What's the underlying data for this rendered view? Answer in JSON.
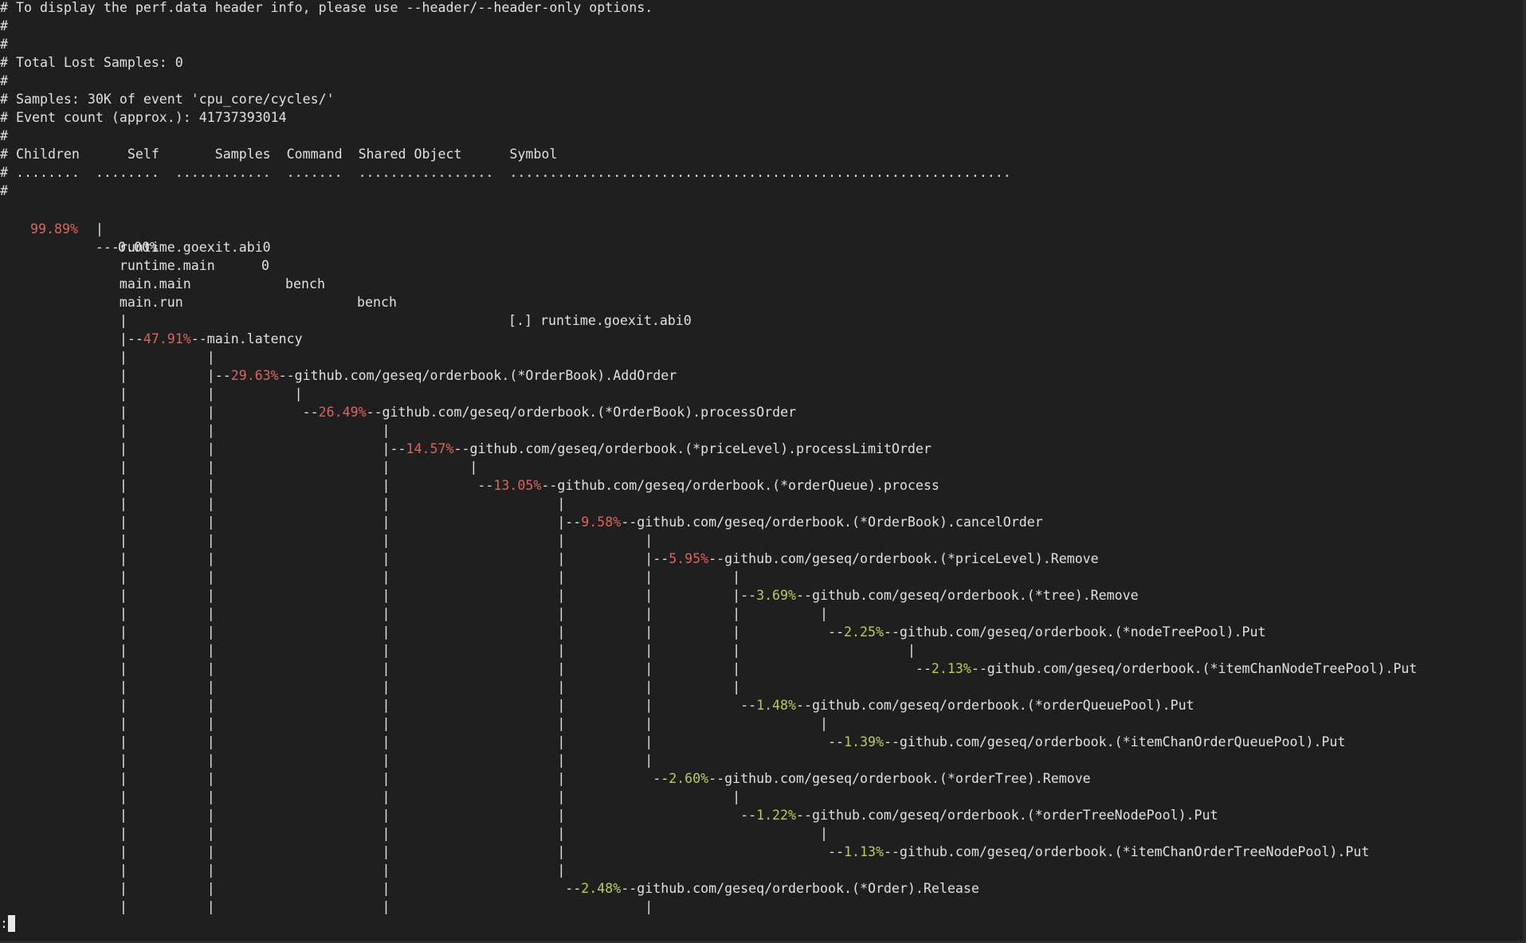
{
  "terminal": {
    "header_lines": [
      "# To display the perf.data header info, please use --header/--header-only options.",
      "#",
      "#",
      "# Total Lost Samples: 0",
      "#",
      "# Samples: 30K of event 'cpu_core/cycles/'",
      "# Event count (approx.): 41737393014",
      "#",
      "# Children      Self       Samples  Command  Shared Object      Symbol",
      "# ........  ........  ............  .......  .................  ...............................................................",
      "#"
    ],
    "top_row": {
      "children": "99.89%",
      "self": "0.00%",
      "samples": "0",
      "command": "bench",
      "shared_object": "bench",
      "symbol": "[.] runtime.goexit.abi0"
    },
    "tree_lines": [
      {
        "pre": "            |",
        "pct": "",
        "post": ""
      },
      {
        "pre": "            ---runtime.goexit.abi0",
        "pct": "",
        "post": ""
      },
      {
        "pre": "               runtime.main",
        "pct": "",
        "post": ""
      },
      {
        "pre": "               main.main",
        "pct": "",
        "post": ""
      },
      {
        "pre": "               main.run",
        "pct": "",
        "post": ""
      },
      {
        "pre": "               |",
        "pct": "",
        "post": ""
      },
      {
        "pre": "               |--",
        "pct": "47.91%",
        "color": "red",
        "post": "--main.latency"
      },
      {
        "pre": "               |          |",
        "pct": "",
        "post": ""
      },
      {
        "pre": "               |          |--",
        "pct": "29.63%",
        "color": "red",
        "post": "--github.com/geseq/orderbook.(*OrderBook).AddOrder"
      },
      {
        "pre": "               |          |          |",
        "pct": "",
        "post": ""
      },
      {
        "pre": "               |          |           --",
        "pct": "26.49%",
        "color": "red",
        "post": "--github.com/geseq/orderbook.(*OrderBook).processOrder"
      },
      {
        "pre": "               |          |                     |",
        "pct": "",
        "post": ""
      },
      {
        "pre": "               |          |                     |--",
        "pct": "14.57%",
        "color": "red",
        "post": "--github.com/geseq/orderbook.(*priceLevel).processLimitOrder"
      },
      {
        "pre": "               |          |                     |          |",
        "pct": "",
        "post": ""
      },
      {
        "pre": "               |          |                     |           --",
        "pct": "13.05%",
        "color": "red",
        "post": "--github.com/geseq/orderbook.(*orderQueue).process"
      },
      {
        "pre": "               |          |                     |                     |",
        "pct": "",
        "post": ""
      },
      {
        "pre": "               |          |                     |                     |--",
        "pct": "9.58%",
        "color": "red",
        "post": "--github.com/geseq/orderbook.(*OrderBook).cancelOrder"
      },
      {
        "pre": "               |          |                     |                     |          |",
        "pct": "",
        "post": ""
      },
      {
        "pre": "               |          |                     |                     |          |--",
        "pct": "5.95%",
        "color": "red",
        "post": "--github.com/geseq/orderbook.(*priceLevel).Remove"
      },
      {
        "pre": "               |          |                     |                     |          |          |",
        "pct": "",
        "post": ""
      },
      {
        "pre": "               |          |                     |                     |          |          |--",
        "pct": "3.69%",
        "color": "green",
        "post": "--github.com/geseq/orderbook.(*tree).Remove"
      },
      {
        "pre": "               |          |                     |                     |          |          |          |",
        "pct": "",
        "post": ""
      },
      {
        "pre": "               |          |                     |                     |          |          |           --",
        "pct": "2.25%",
        "color": "green",
        "post": "--github.com/geseq/orderbook.(*nodeTreePool).Put"
      },
      {
        "pre": "               |          |                     |                     |          |          |                     |",
        "pct": "",
        "post": ""
      },
      {
        "pre": "               |          |                     |                     |          |          |                      --",
        "pct": "2.13%",
        "color": "green",
        "post": "--github.com/geseq/orderbook.(*itemChanNodeTreePool).Put"
      },
      {
        "pre": "               |          |                     |                     |          |          |",
        "pct": "",
        "post": ""
      },
      {
        "pre": "               |          |                     |                     |          |           --",
        "pct": "1.48%",
        "color": "green",
        "post": "--github.com/geseq/orderbook.(*orderQueuePool).Put"
      },
      {
        "pre": "               |          |                     |                     |          |                     |",
        "pct": "",
        "post": ""
      },
      {
        "pre": "               |          |                     |                     |          |                      --",
        "pct": "1.39%",
        "color": "green",
        "post": "--github.com/geseq/orderbook.(*itemChanOrderQueuePool).Put"
      },
      {
        "pre": "               |          |                     |                     |          |",
        "pct": "",
        "post": ""
      },
      {
        "pre": "               |          |                     |                     |           --",
        "pct": "2.60%",
        "color": "green",
        "post": "--github.com/geseq/orderbook.(*orderTree).Remove"
      },
      {
        "pre": "               |          |                     |                     |                     |",
        "pct": "",
        "post": ""
      },
      {
        "pre": "               |          |                     |                     |                      --",
        "pct": "1.22%",
        "color": "green",
        "post": "--github.com/geseq/orderbook.(*orderTreeNodePool).Put"
      },
      {
        "pre": "               |          |                     |                     |                                |",
        "pct": "",
        "post": ""
      },
      {
        "pre": "               |          |                     |                     |                                 --",
        "pct": "1.13%",
        "color": "green",
        "post": "--github.com/geseq/orderbook.(*itemChanOrderTreeNodePool).Put"
      },
      {
        "pre": "               |          |                     |                     |",
        "pct": "",
        "post": ""
      },
      {
        "pre": "               |          |                     |                      --",
        "pct": "2.48%",
        "color": "green",
        "post": "--github.com/geseq/orderbook.(*Order).Release"
      },
      {
        "pre": "               |          |                     |                                |",
        "pct": "",
        "post": ""
      }
    ],
    "prompt": ":",
    "colors": {
      "background": "#1f1f1f",
      "text": "#e0e0e0",
      "pct_red": "#d9645e",
      "pct_green": "#b4cf5c"
    }
  }
}
